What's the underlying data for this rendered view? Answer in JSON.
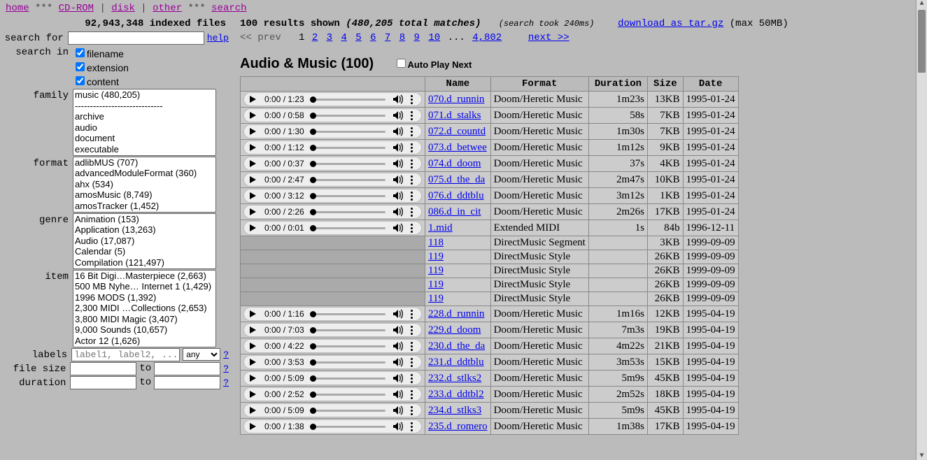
{
  "nav": {
    "home": "home",
    "cdrom": "CD-ROM",
    "disk": "disk",
    "other": "other",
    "search": "search",
    "stars": "***",
    "bar": "|"
  },
  "stats": {
    "indexed": "92,943,348 indexed files"
  },
  "search": {
    "for_label": "search for",
    "in_label": "search in",
    "help": "help",
    "q": "?",
    "filename": "filename",
    "extension": "extension",
    "content": "content",
    "family_label": "family",
    "format_label": "format",
    "genre_label": "genre",
    "item_label": "item",
    "labels_label": "labels",
    "labels_ph": "label1, label2, ...",
    "any": "any",
    "filesize_label": "file size",
    "to": "to",
    "duration_label": "duration",
    "families": [
      "music (480,205)",
      "-----------------------------",
      "archive",
      "audio",
      "document",
      "executable"
    ],
    "formats": [
      "adlibMUS (707)",
      "advancedModuleFormat (360)",
      "ahx (534)",
      "amosMusic (8,749)",
      "amosTracker (1,452)"
    ],
    "genres": [
      "Animation (153)",
      "Application (13,263)",
      "Audio (17,087)",
      "Calendar (5)",
      "Compilation (121,497)"
    ],
    "items": [
      "16 Bit Digi…Masterpiece (2,663)",
      "500 MB Nyhe… Internet 1 (1,429)",
      "1996 MODS (1,392)",
      "2,300 MIDI …Collections (2,653)",
      "3,800 MIDI Magic (3,407)",
      "9,000 Sounds (10,657)",
      "Actor 12 (1,626)"
    ]
  },
  "results": {
    "shown": "100 results shown",
    "total": "(480,205 total matches)",
    "took": "(search took 240ms)",
    "download": "download as tar.gz",
    "max": "(max 50MB)",
    "prev": "<< prev",
    "pages": [
      "1",
      "2",
      "3",
      "4",
      "5",
      "6",
      "7",
      "8",
      "9",
      "10"
    ],
    "dots": "...",
    "last": "4,802",
    "next": "next >>",
    "heading": "Audio & Music (100)",
    "autoplay": "Auto Play Next",
    "cols": {
      "name": "Name",
      "format": "Format",
      "duration": "Duration",
      "size": "Size",
      "date": "Date"
    }
  },
  "rows": [
    {
      "p": true,
      "t": "0:00 / 1:23",
      "name": "070.d_runnin",
      "fmt": "Doom/Heretic Music",
      "dur": "1m23s",
      "size": "13KB",
      "date": "1995-01-24"
    },
    {
      "p": true,
      "t": "0:00 / 0:58",
      "name": "071.d_stalks",
      "fmt": "Doom/Heretic Music",
      "dur": "58s",
      "size": "7KB",
      "date": "1995-01-24"
    },
    {
      "p": true,
      "t": "0:00 / 1:30",
      "name": "072.d_countd",
      "fmt": "Doom/Heretic Music",
      "dur": "1m30s",
      "size": "7KB",
      "date": "1995-01-24"
    },
    {
      "p": true,
      "t": "0:00 / 1:12",
      "name": "073.d_betwee",
      "fmt": "Doom/Heretic Music",
      "dur": "1m12s",
      "size": "9KB",
      "date": "1995-01-24"
    },
    {
      "p": true,
      "t": "0:00 / 0:37",
      "name": "074.d_doom",
      "fmt": "Doom/Heretic Music",
      "dur": "37s",
      "size": "4KB",
      "date": "1995-01-24"
    },
    {
      "p": true,
      "t": "0:00 / 2:47",
      "name": "075.d_the_da",
      "fmt": "Doom/Heretic Music",
      "dur": "2m47s",
      "size": "10KB",
      "date": "1995-01-24"
    },
    {
      "p": true,
      "t": "0:00 / 3:12",
      "name": "076.d_ddtblu",
      "fmt": "Doom/Heretic Music",
      "dur": "3m12s",
      "size": "1KB",
      "date": "1995-01-24"
    },
    {
      "p": true,
      "t": "0:00 / 2:26",
      "name": "086.d_in_cit",
      "fmt": "Doom/Heretic Music",
      "dur": "2m26s",
      "size": "17KB",
      "date": "1995-01-24"
    },
    {
      "p": true,
      "t": "0:00 / 0:01",
      "name": "1.mid",
      "fmt": "Extended MIDI",
      "dur": "1s",
      "size": "84b",
      "date": "1996-12-11"
    },
    {
      "p": false,
      "name": "118",
      "fmt": "DirectMusic Segment",
      "dur": "",
      "size": "3KB",
      "date": "1999-09-09"
    },
    {
      "p": false,
      "name": "119",
      "fmt": "DirectMusic Style",
      "dur": "",
      "size": "26KB",
      "date": "1999-09-09"
    },
    {
      "p": false,
      "name": "119",
      "fmt": "DirectMusic Style",
      "dur": "",
      "size": "26KB",
      "date": "1999-09-09"
    },
    {
      "p": false,
      "name": "119",
      "fmt": "DirectMusic Style",
      "dur": "",
      "size": "26KB",
      "date": "1999-09-09"
    },
    {
      "p": false,
      "name": "119",
      "fmt": "DirectMusic Style",
      "dur": "",
      "size": "26KB",
      "date": "1999-09-09"
    },
    {
      "p": true,
      "t": "0:00 / 1:16",
      "name": "228.d_runnin",
      "fmt": "Doom/Heretic Music",
      "dur": "1m16s",
      "size": "12KB",
      "date": "1995-04-19"
    },
    {
      "p": true,
      "t": "0:00 / 7:03",
      "name": "229.d_doom",
      "fmt": "Doom/Heretic Music",
      "dur": "7m3s",
      "size": "19KB",
      "date": "1995-04-19"
    },
    {
      "p": true,
      "t": "0:00 / 4:22",
      "name": "230.d_the_da",
      "fmt": "Doom/Heretic Music",
      "dur": "4m22s",
      "size": "21KB",
      "date": "1995-04-19"
    },
    {
      "p": true,
      "t": "0:00 / 3:53",
      "name": "231.d_ddtblu",
      "fmt": "Doom/Heretic Music",
      "dur": "3m53s",
      "size": "15KB",
      "date": "1995-04-19"
    },
    {
      "p": true,
      "t": "0:00 / 5:09",
      "name": "232.d_stlks2",
      "fmt": "Doom/Heretic Music",
      "dur": "5m9s",
      "size": "45KB",
      "date": "1995-04-19"
    },
    {
      "p": true,
      "t": "0:00 / 2:52",
      "name": "233.d_ddtbl2",
      "fmt": "Doom/Heretic Music",
      "dur": "2m52s",
      "size": "18KB",
      "date": "1995-04-19"
    },
    {
      "p": true,
      "t": "0:00 / 5:09",
      "name": "234.d_stlks3",
      "fmt": "Doom/Heretic Music",
      "dur": "5m9s",
      "size": "45KB",
      "date": "1995-04-19"
    },
    {
      "p": true,
      "t": "0:00 / 1:38",
      "name": "235.d_romero",
      "fmt": "Doom/Heretic Music",
      "dur": "1m38s",
      "size": "17KB",
      "date": "1995-04-19"
    }
  ]
}
